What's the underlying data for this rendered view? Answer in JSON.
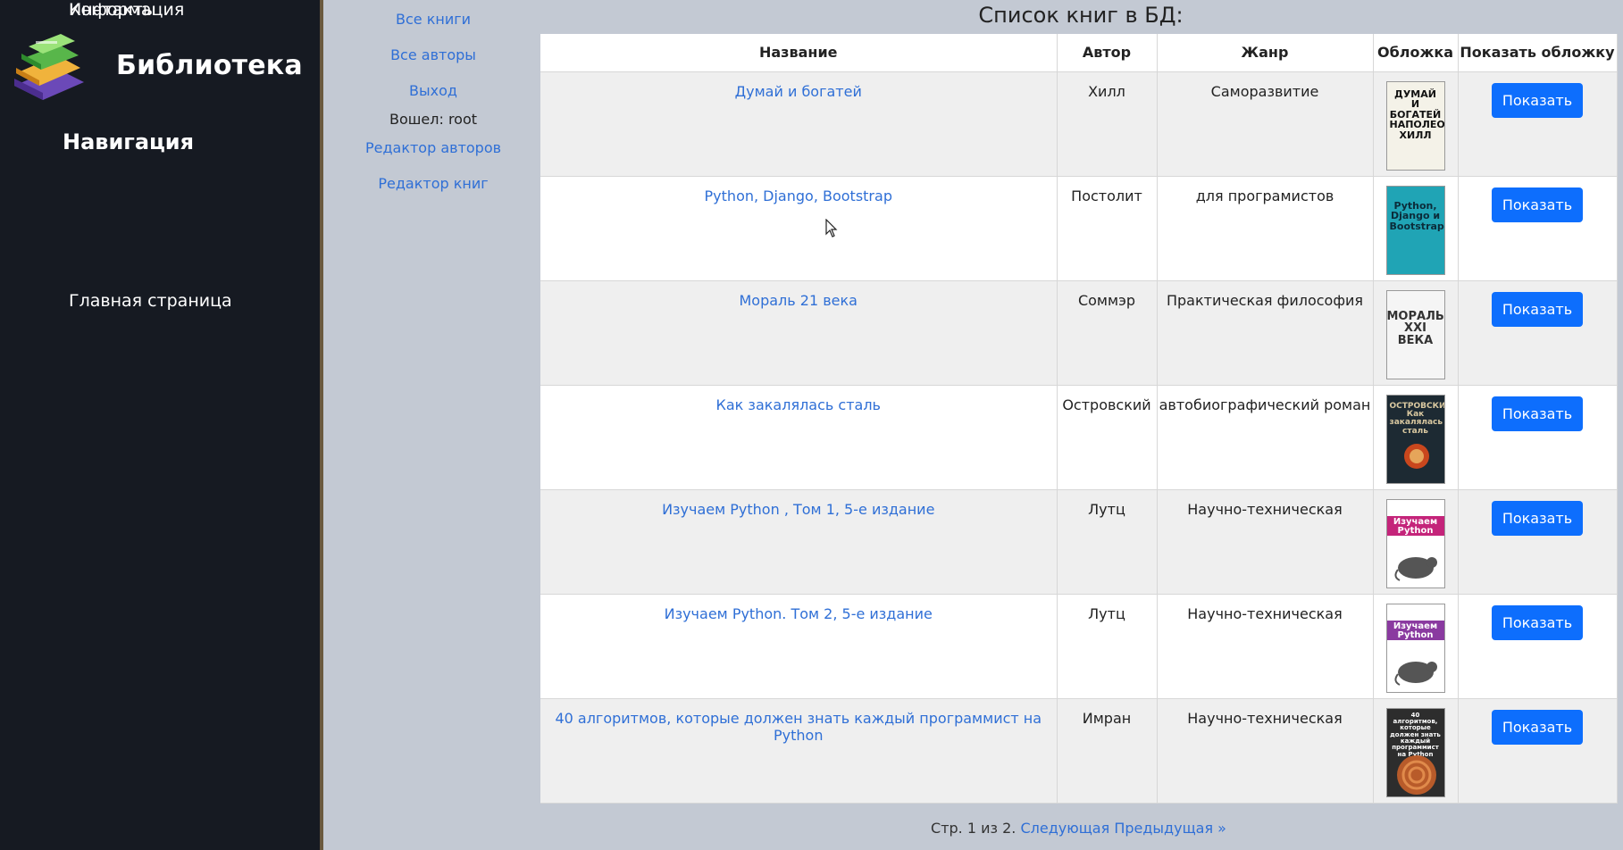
{
  "sidebar": {
    "brand": "Библиотека",
    "heading": "Навигация",
    "items": [
      {
        "label": "Главная страница"
      },
      {
        "label": "Информация"
      },
      {
        "label": "Контакты"
      }
    ]
  },
  "subnav": {
    "links": [
      "Все книги",
      "Все авторы",
      "Выход"
    ],
    "logged_in": "Вошел: root",
    "editor_authors": "Редактор авторов",
    "editor_books": "Редактор книг"
  },
  "page": {
    "title": "Список книг в БД:"
  },
  "table": {
    "headers": [
      "Название",
      "Автор",
      "Жанр",
      "Обложка",
      "Показать обложку"
    ],
    "rows": [
      {
        "title": "Думай и богатей",
        "author": "Хилл",
        "genre": "Саморазвитие",
        "cover_text": "ДУМАЙ И БОГАТЕЙ НАПОЛЕОН ХИЛЛ",
        "button": "Показать"
      },
      {
        "title": "Python, Django, Bootstrap",
        "author": "Постолит",
        "genre": "для програмистов",
        "cover_text": "Python, Django и Bootstrap",
        "button": "Показать"
      },
      {
        "title": "Мораль 21 века",
        "author": "Соммэр",
        "genre": "Практическая философия",
        "cover_text": "МОРАЛЬ XXI ВЕКА",
        "button": "Показать"
      },
      {
        "title": "Как закалялась сталь",
        "author": "Островский",
        "genre": "автобиографический роман",
        "cover_text": "ОСТРОВСКИЙ Как закалялась сталь",
        "button": "Показать"
      },
      {
        "title": "Изучаем Python , Том 1, 5-е издание",
        "author": "Лутц",
        "genre": "Научно-техническая",
        "cover_text": "Изучаем Python",
        "button": "Показать"
      },
      {
        "title": "Изучаем Python. Том 2, 5-е издание",
        "author": "Лутц",
        "genre": "Научно-техническая",
        "cover_text": "Изучаем Python",
        "button": "Показать"
      },
      {
        "title": "40 алгоритмов, которые должен знать каждый программист на Python",
        "author": "Имран",
        "genre": "Научно-техническая",
        "cover_text": "40 алгоритмов, которые должен знать каждый программист на Python",
        "button": "Показать"
      }
    ]
  },
  "pagination": {
    "text": "Стр. 1 из 2.",
    "next": "Следующая",
    "prev": "Предыдущая »"
  }
}
